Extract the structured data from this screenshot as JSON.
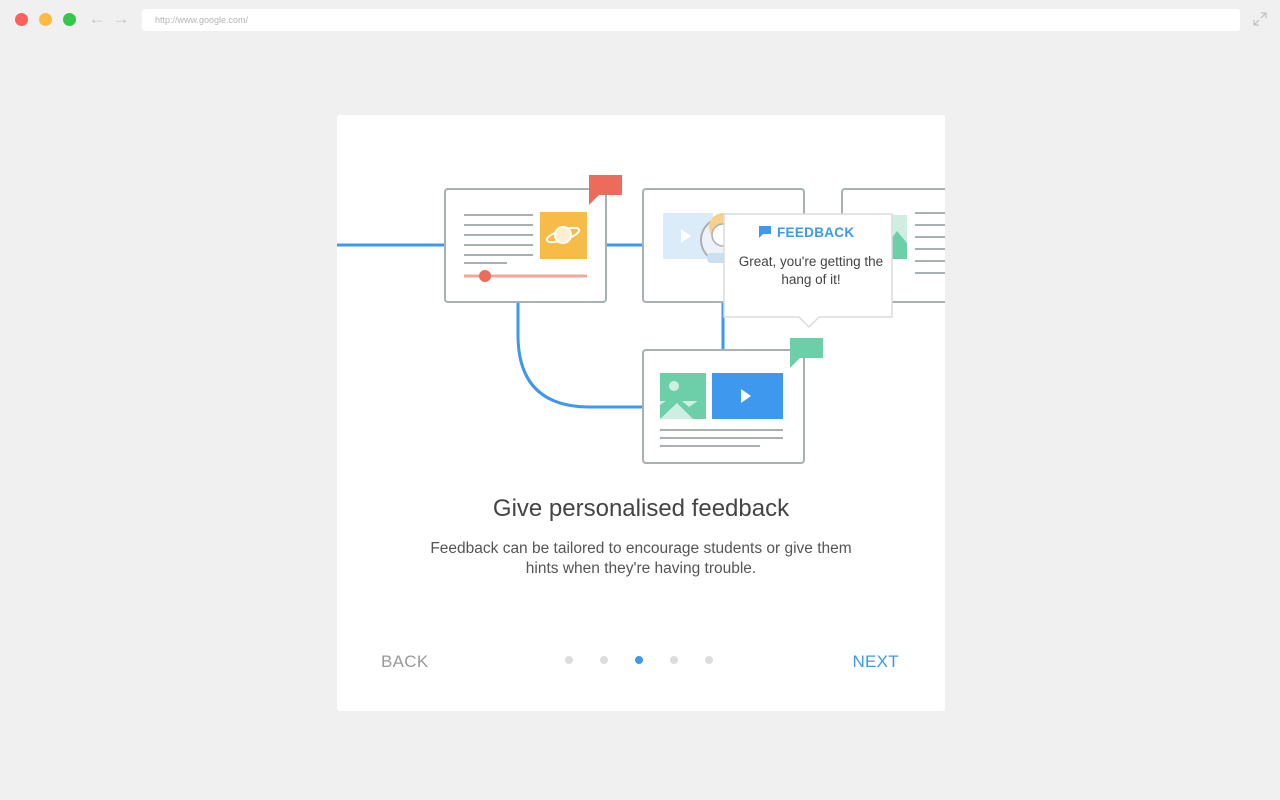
{
  "browser": {
    "url": "http://www.google.com/"
  },
  "icons": {
    "back": "arrow-left-icon",
    "forward": "arrow-right-icon",
    "expand": "expand-icon",
    "flag": "flag-icon",
    "play": "play-icon",
    "image": "image-icon",
    "planet": "planet-icon"
  },
  "illustration": {
    "tooltip_title": "FEEDBACK",
    "tooltip_text": "Great, you're getting the hang of it!"
  },
  "onboarding": {
    "title": "Give personalised feedback",
    "description": "Feedback can be tailored to encourage students or give them hints when they're having trouble.",
    "back_label": "BACK",
    "next_label": "NEXT",
    "total_steps": 5,
    "current_step": 3
  },
  "colors": {
    "accent": "#3d98ee",
    "flag_red": "#ec6b5a",
    "flag_green": "#6ccfa9",
    "tile_yellow": "#f7bb48",
    "slider_red": "#f0a89c"
  }
}
